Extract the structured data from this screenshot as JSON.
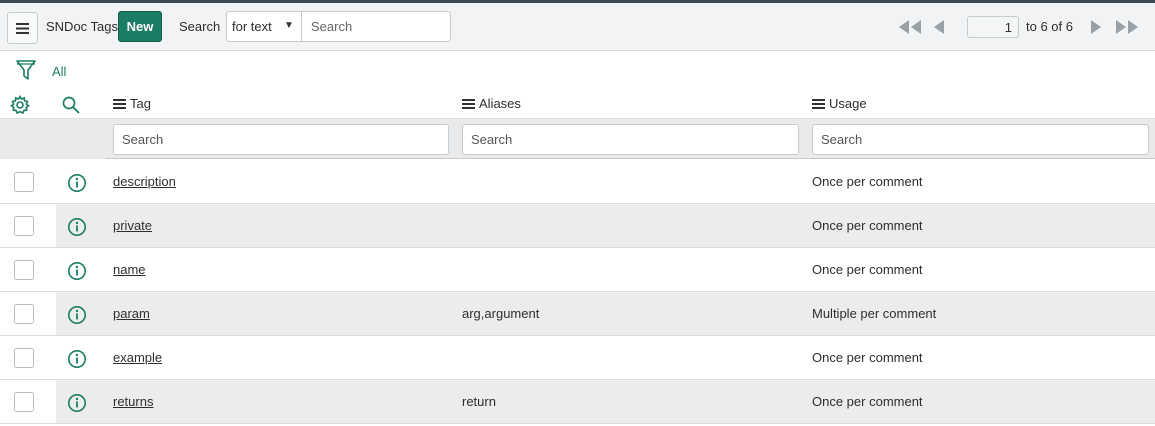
{
  "header": {
    "title": "SNDoc Tags",
    "new_label": "New",
    "search_label": "Search",
    "search_field_select": "for text",
    "search_placeholder": "Search",
    "pager": {
      "current_page": "1",
      "range_text": "to 6 of 6"
    }
  },
  "filter": {
    "label": "All"
  },
  "columns": [
    {
      "label": "Tag",
      "search_placeholder": "Search"
    },
    {
      "label": "Aliases",
      "search_placeholder": "Search"
    },
    {
      "label": "Usage",
      "search_placeholder": "Search"
    }
  ],
  "rows": [
    {
      "tag": "description",
      "aliases": "",
      "usage": "Once per comment"
    },
    {
      "tag": "private",
      "aliases": "",
      "usage": "Once per comment"
    },
    {
      "tag": "name",
      "aliases": "",
      "usage": "Once per comment"
    },
    {
      "tag": "param",
      "aliases": "arg,argument",
      "usage": "Multiple per comment"
    },
    {
      "tag": "example",
      "aliases": "",
      "usage": "Once per comment"
    },
    {
      "tag": "returns",
      "aliases": "return",
      "usage": "Once per comment"
    }
  ],
  "colors": {
    "accent": "#1b7d63",
    "header_bg": "#f1f3f4",
    "alt_row": "#ececec"
  }
}
